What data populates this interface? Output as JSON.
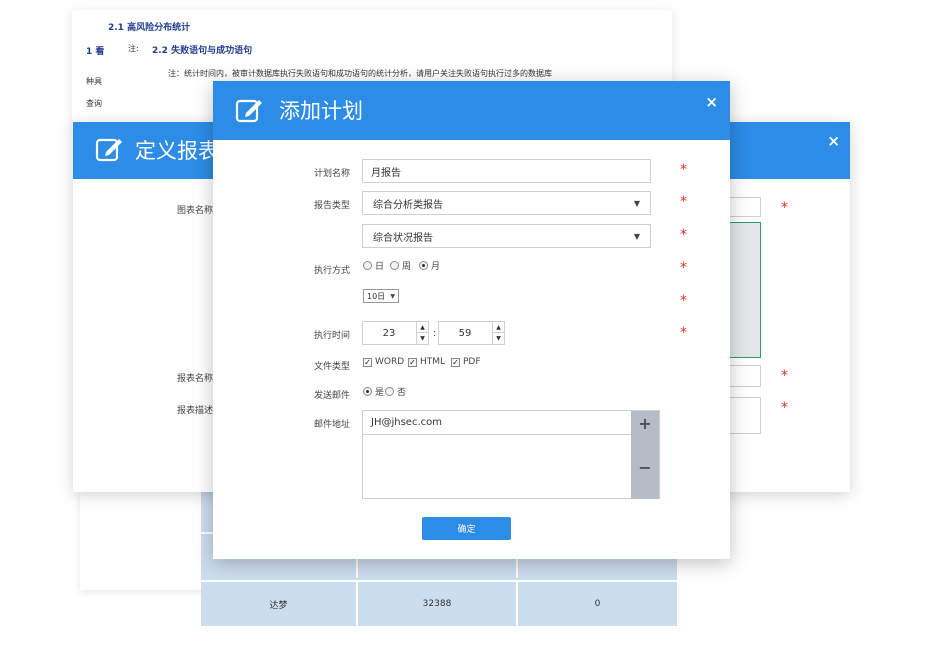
{
  "doc": {
    "heading1": "2.1 高风险分布统计",
    "num": "1 看",
    "heading2_lead": "注:",
    "heading2": "2.2 失败语句与成功语句",
    "note": "注：统计时间内，被审计数据库执行失败语句和成功语句的统计分析，请用户关注失败语句执行过多的数据库",
    "side1": "种具",
    "side2": "查询"
  },
  "table": {
    "rows": [
      {
        "name": "",
        "v1": "",
        "v2": ""
      },
      {
        "name": "",
        "v1": "",
        "v2": ""
      },
      {
        "name": "达梦",
        "v1": "32388",
        "v2": "0"
      }
    ]
  },
  "report_dialog": {
    "title": "定义报表",
    "close": "×",
    "chart_name_label": "图表名称",
    "report_name_label": "报表名称",
    "report_desc_label": "报表描述",
    "required_mark": "*"
  },
  "plan_dialog": {
    "title": "添加计划",
    "close": "×",
    "required_mark": "*",
    "plan_name_label": "计划名称",
    "plan_name_value": "月报告",
    "report_type_label": "报告类型",
    "report_type_value": "综合分析类报告",
    "report_subtype_value": "综合状况报告",
    "exec_mode_label": "执行方式",
    "exec_mode_options": [
      "日",
      "周",
      "月"
    ],
    "exec_mode_selected": "月",
    "day_select_value": "10日",
    "exec_time_label": "执行时间",
    "hour_value": "23",
    "minute_value": "59",
    "time_sep": ":",
    "file_type_label": "文件类型",
    "file_types": [
      "WORD",
      "HTML",
      "PDF"
    ],
    "send_mail_label": "发送邮件",
    "send_mail_options": [
      "是",
      "否"
    ],
    "mail_label": "邮件地址",
    "mail_value": "JH@jhsec.com",
    "add_button": "+",
    "remove_button": "−",
    "confirm_button": "确定"
  },
  "colors": {
    "accent": "#2c8ce6",
    "required": "#e0312f",
    "table_bg": "#cdddf0"
  }
}
